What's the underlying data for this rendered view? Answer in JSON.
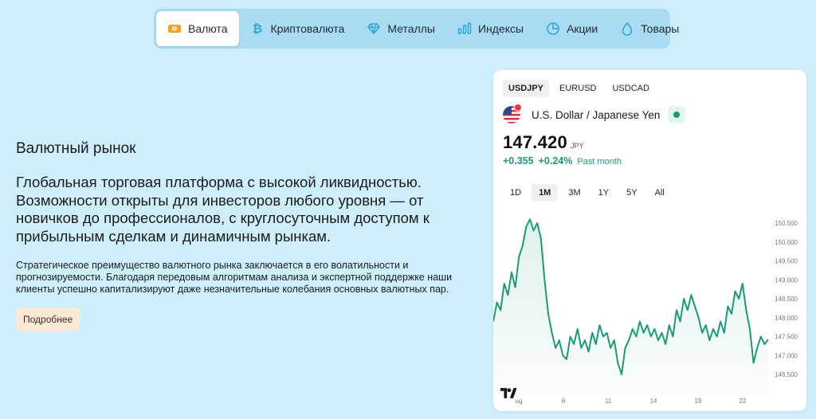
{
  "nav": {
    "items": [
      {
        "label": "Валюта",
        "icon": "currency-icon"
      },
      {
        "label": "Криптовалюта",
        "icon": "bitcoin-icon"
      },
      {
        "label": "Металлы",
        "icon": "diamond-icon"
      },
      {
        "label": "Индексы",
        "icon": "bars-icon"
      },
      {
        "label": "Акции",
        "icon": "pie-chart-icon"
      },
      {
        "label": "Товары",
        "icon": "drop-icon"
      }
    ],
    "active_index": 0
  },
  "content": {
    "heading": "Валютный рынок",
    "lead": "Глобальная торговая платформа с высокой ликвидностью. Возможности открыты для инвесторов любого уровня — от новичков до профессионалов, с круглосуточным доступом к прибыльным сделкам и динамичным рынкам.",
    "body": "Стратегическое преимущество валютного рынка заключается в его волатильности и прогнозируемости. Благодаря передовым алгоритмам анализа и экспертной поддержке наши клиенты успешно капитализируют даже незначительные колебания основных валютных пар.",
    "button": "Подробнее"
  },
  "widget": {
    "pairs": [
      "USDJPY",
      "EURUSD",
      "USDCAD"
    ],
    "active_pair": 0,
    "symbol_name": "U.S. Dollar / Japanese Yen",
    "price": "147.420",
    "currency": "JPY",
    "change_abs": "+0.355",
    "change_pct": "+0.24%",
    "period": "Past month",
    "ranges": [
      "1D",
      "1M",
      "3M",
      "1Y",
      "5Y",
      "All"
    ],
    "active_range": 1,
    "colors": {
      "accent": "#1a9b78",
      "line": "#1a9b78"
    }
  },
  "chart_data": {
    "type": "area",
    "x_ticks": [
      "ug",
      "6",
      "11",
      "14",
      "19",
      "22"
    ],
    "y_ticks": [
      "150.500",
      "150.000",
      "149.500",
      "149.000",
      "148.500",
      "148.000",
      "147.500",
      "147.000",
      "146.500"
    ],
    "ylim": [
      146.5,
      150.5
    ],
    "series": [
      {
        "values": [
          147.9,
          148.4,
          148.2,
          148.9,
          148.6,
          149.2,
          148.8,
          149.6,
          149.9,
          150.4,
          150.6,
          150.3,
          150.5,
          150.1,
          149.0,
          148.1,
          147.6,
          147.2,
          147.4,
          147.0,
          146.9,
          147.5,
          147.3,
          147.7,
          147.2,
          147.4,
          147.1,
          147.6,
          147.3,
          147.8,
          147.5,
          147.6,
          147.2,
          147.4,
          146.8,
          146.5,
          147.2,
          147.4,
          147.7,
          147.5,
          147.9,
          147.6,
          147.8,
          147.5,
          147.7,
          147.4,
          147.6,
          147.3,
          147.8,
          147.5,
          148.2,
          147.9,
          148.5,
          148.2,
          148.6,
          148.3,
          148.0,
          147.6,
          147.8,
          147.4,
          147.7,
          147.5,
          147.9,
          147.6,
          148.3,
          148.1,
          148.7,
          148.5,
          148.9,
          148.2,
          147.7,
          146.8,
          147.2,
          147.5,
          147.3,
          147.42
        ]
      }
    ]
  }
}
